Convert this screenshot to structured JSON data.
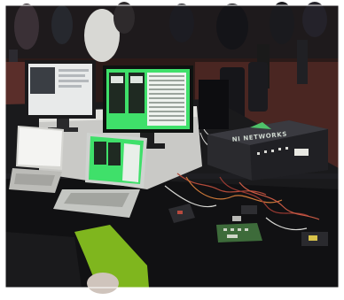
{
  "photo": {
    "equipment_label": "NI NETWORKS"
  },
  "colors": {
    "frame": "#ffffff",
    "carpet": "#3a1e1c",
    "tablecloth": "#121214",
    "monitor_glow": "#3fe06a",
    "device_case": "#2a2a2e",
    "circuit_board": "#3d6b3a",
    "cushion": "#7fb61e"
  },
  "icons": [
    "laptop",
    "monitor",
    "hardware-case",
    "circuit-board",
    "cables"
  ]
}
